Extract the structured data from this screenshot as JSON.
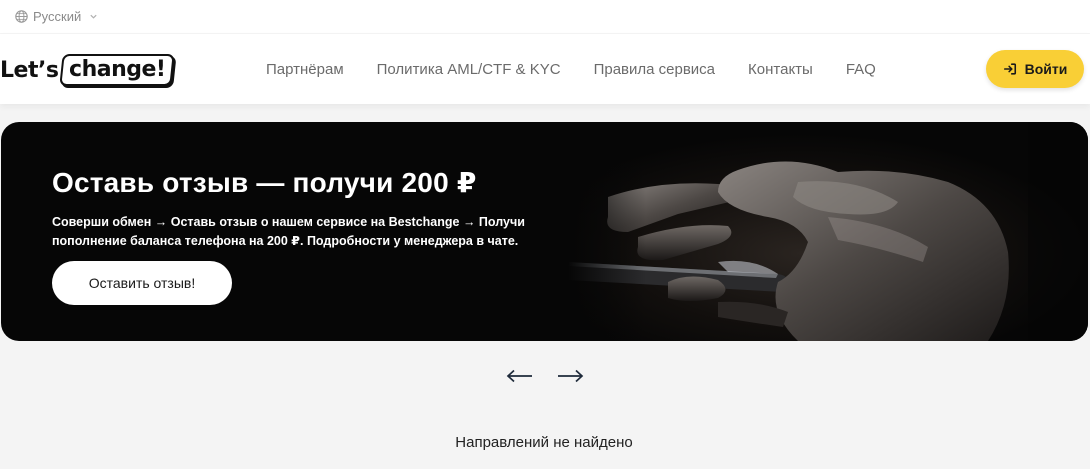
{
  "language": {
    "label": "Русский",
    "icon": "globe-icon"
  },
  "logo": {
    "lets": "Let’s",
    "change": "change!"
  },
  "nav": {
    "items": [
      {
        "label": "Партнёрам"
      },
      {
        "label": "Политика AML/CTF & KYC"
      },
      {
        "label": "Правила сервиса"
      },
      {
        "label": "Контакты"
      },
      {
        "label": "FAQ"
      }
    ]
  },
  "login": {
    "label": "Войти",
    "icon": "login-icon",
    "color": "#f9cf36"
  },
  "banner": {
    "title": "Оставь отзыв — получи 200 ₽",
    "description": "Соверши обмен → Оставь отзыв о нашем сервисе на Bestchange → Получи пополнение баланса телефона на 200 ₽. Подробности у менеджера в чате.",
    "cta": "Оставить отзыв!"
  },
  "slider": {
    "prev_icon": "arrow-left-icon",
    "next_icon": "arrow-right-icon"
  },
  "directions": {
    "empty_text": "Направлений не найдено"
  }
}
